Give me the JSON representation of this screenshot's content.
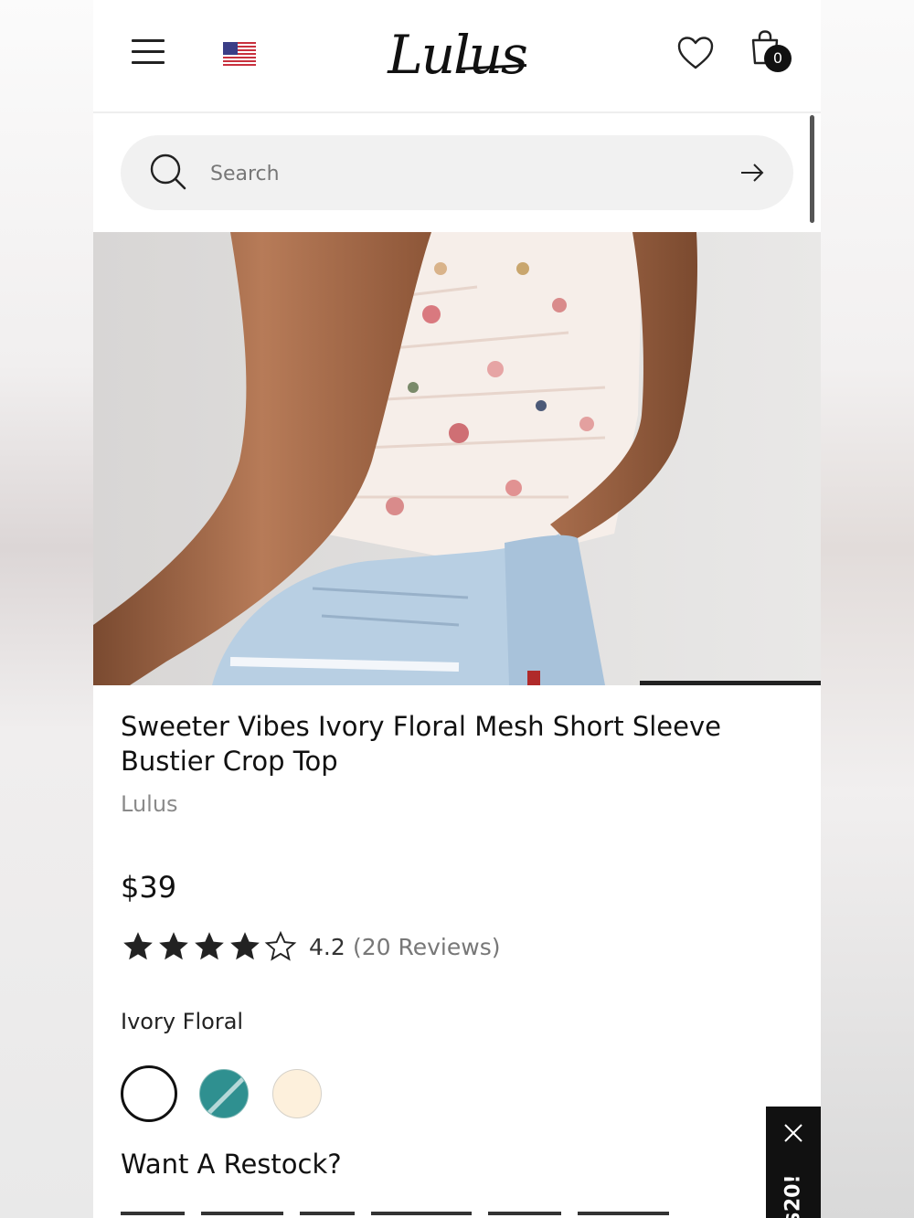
{
  "header": {
    "logo_text": "Lulus",
    "cart_count": "0",
    "flag_icon": "us-flag-icon"
  },
  "search": {
    "placeholder": "Search"
  },
  "product": {
    "title": "Sweeter Vibes Ivory Floral Mesh Short Sleeve Bustier Crop Top",
    "brand": "Lulus",
    "price": "$39",
    "rating": {
      "value": "4.2",
      "reviews_label": "(20 Reviews)",
      "stars_filled": 4,
      "stars_total": 5
    },
    "selected_color": "Ivory Floral",
    "swatches": [
      {
        "name": "ivory-floral",
        "color": "#ffffff",
        "selected": true
      },
      {
        "name": "teal",
        "color": "#2f9090",
        "selected": false
      },
      {
        "name": "cream",
        "color": "#fdf0dc",
        "selected": false
      }
    ],
    "restock_heading": "Want A Restock?"
  },
  "promo": {
    "label": "$20!"
  },
  "colors": {
    "text": "#111111",
    "muted": "#8a8a8a",
    "search_bg": "#f1f1f1",
    "promo_bg": "#111111"
  }
}
